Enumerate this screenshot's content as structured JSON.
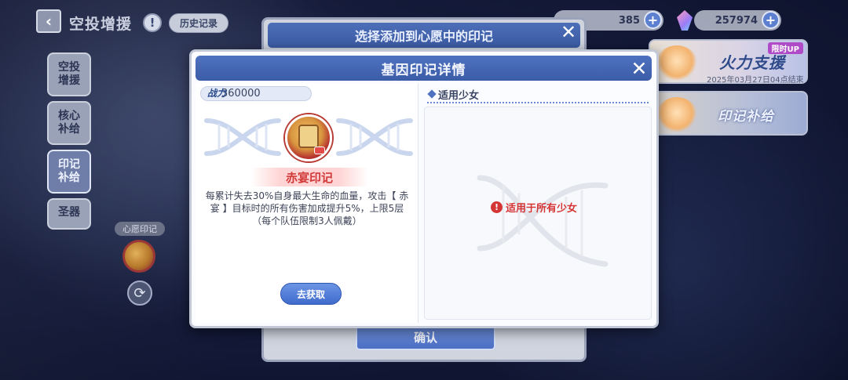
{
  "header": {
    "back_icon": "chevron-left-icon",
    "title": "空投增援",
    "info_icon": "exclamation-icon",
    "history_label": "历史记录"
  },
  "side_tabs": [
    {
      "label": "空投\n增援",
      "active": false
    },
    {
      "label": "核心\n补给",
      "active": false
    },
    {
      "label": "印记\n补给",
      "active": true
    },
    {
      "label": "圣器",
      "active": false
    }
  ],
  "wish": {
    "label": "心愿印记",
    "refresh_icon": "refresh-icon"
  },
  "currency": [
    {
      "value": "385",
      "icon": "coin-icon"
    },
    {
      "value": "257974",
      "icon": "gem-icon"
    }
  ],
  "banners": [
    {
      "limit_tag": "限时UP",
      "title": "火力支援",
      "date": "2025年03月27日04点结束"
    },
    {
      "title": "印记补给"
    }
  ],
  "back_modal": {
    "title": "选择添加到心愿中的印记",
    "confirm_label": "确认"
  },
  "modal": {
    "title": "基因印记详情",
    "power_label": "战力",
    "power_value": "360000",
    "mark_name": "赤宴印记",
    "description": "每累计失去30%自身最大生命的血量，攻击【 赤宴 】目标时的所有伤害加成提升5%，上限5层（每个队伍限制3人佩戴）",
    "acquire_label": "去获取",
    "applicable_header": "适用少女",
    "applicable_text": "适用于所有少女"
  },
  "colors": {
    "header_blue": "#4f72c0",
    "mark_red": "#d23a3a",
    "warning_red": "#d43535"
  }
}
